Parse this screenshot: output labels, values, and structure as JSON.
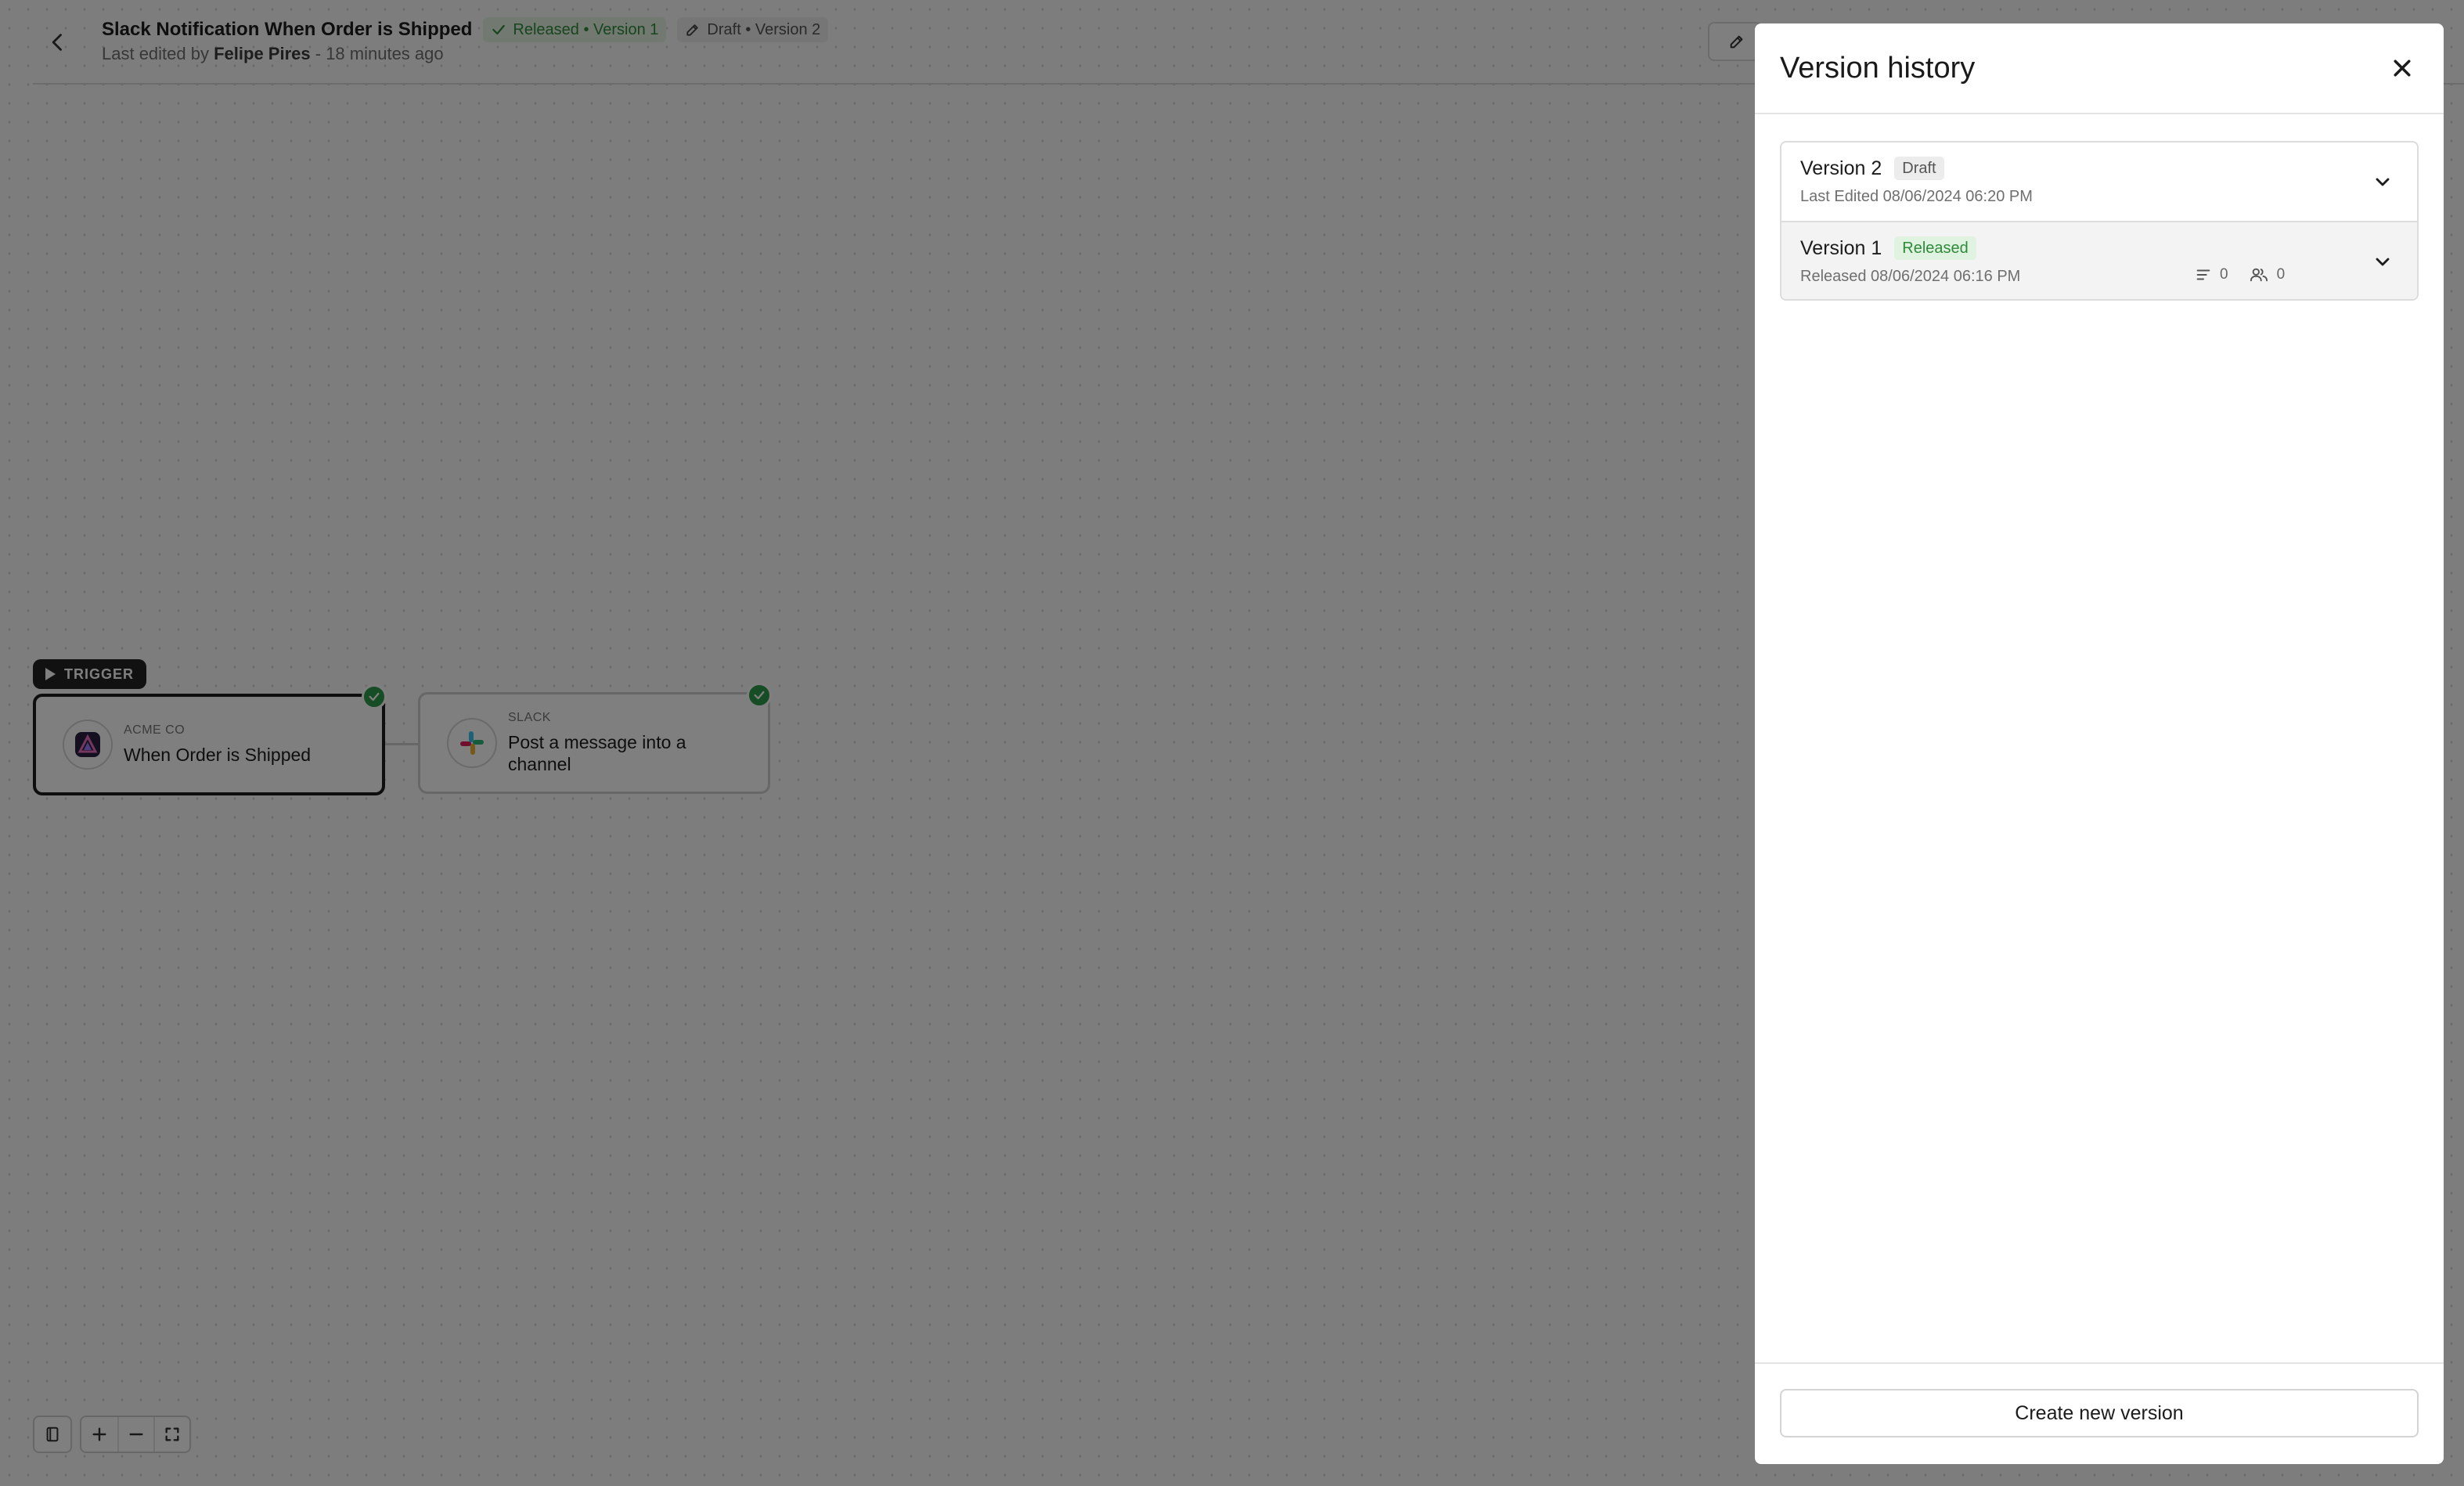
{
  "header": {
    "title": "Slack Notification When Order is Shipped",
    "released_tag": "Released • Version 1",
    "draft_tag": "Draft • Version 2",
    "subtitle_prefix": "Last edited by",
    "editor": "Felipe Pires",
    "subtitle_suffix": "- 18 minutes ago"
  },
  "workflow": {
    "trigger_label": "TRIGGER",
    "nodes": [
      {
        "kicker": "ACME CO",
        "label": "When Order is Shipped",
        "icon": "acme-logo-icon",
        "status": "complete"
      },
      {
        "kicker": "SLACK",
        "label": "Post a message into a channel",
        "icon": "slack-logo-icon",
        "status": "complete"
      }
    ]
  },
  "version_history": {
    "title": "Version history",
    "versions": [
      {
        "name": "Version 2",
        "badge": "Draft",
        "date": "Last Edited 08/06/2024 06:20 PM"
      },
      {
        "name": "Version 1",
        "badge": "Released",
        "date": "Released 08/06/2024 06:16 PM",
        "steps_count": "0",
        "users_count": "0"
      }
    ],
    "create_button": "Create new version"
  },
  "colors": {
    "released_green": "#2f8a3a",
    "check_green": "#2f9a48",
    "overlay": "rgba(0,0,0,0.5)",
    "dark": "#1c1c1c"
  }
}
